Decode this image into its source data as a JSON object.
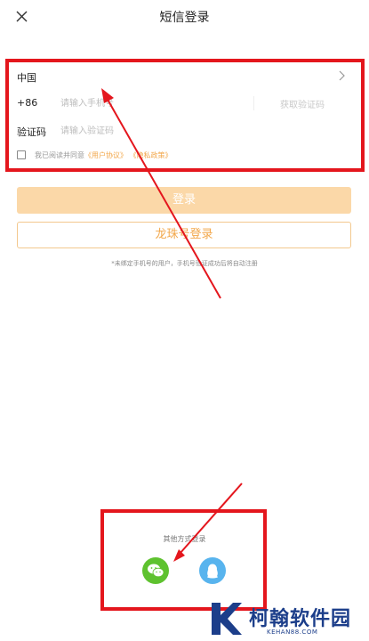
{
  "header": {
    "title": "短信登录",
    "close_icon": "close-icon"
  },
  "form": {
    "country_label": "中国",
    "phone_prefix": "+86",
    "phone_placeholder": "请输入手机号",
    "get_code_label": "获取验证码",
    "code_label": "验证码",
    "code_placeholder": "请输入验证码"
  },
  "agreement": {
    "prefix": "我已阅读并同意",
    "user_agreement": "《用户协议》",
    "privacy_policy": "《隐私政策》"
  },
  "buttons": {
    "login": "登录",
    "alternate_login": "龙珠号登录"
  },
  "hint": "*未绑定手机号的用户，手机号验证成功后将自动注册",
  "other_login": {
    "label": "其他方式登录",
    "options": [
      {
        "name": "wechat",
        "icon": "wechat-icon",
        "color": "#5ec22f"
      },
      {
        "name": "qq",
        "icon": "qq-icon",
        "color": "#58b4ee"
      }
    ]
  },
  "watermark": {
    "brand": "柯翰软件园",
    "url": "KEHAN88.COM"
  },
  "colors": {
    "accent": "#f2a74a",
    "login_button": "#fbd8a8",
    "annotation_red": "#e4161d",
    "watermark_blue": "#1c3e8a"
  }
}
